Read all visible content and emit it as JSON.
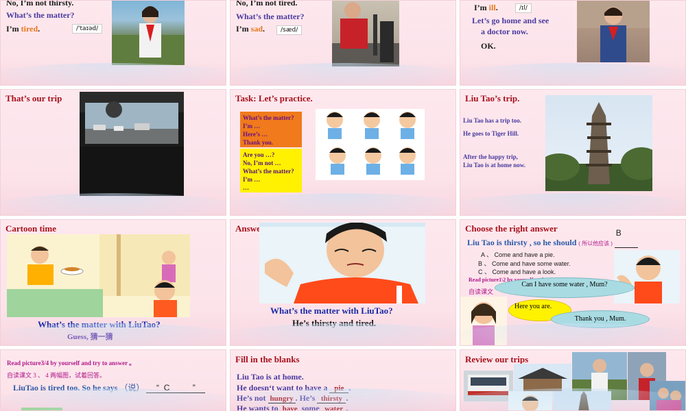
{
  "slide1": {
    "line1": "No, I’m not thirsty.",
    "line2": "What’s the matter?",
    "line3_prefix": "I’m ",
    "line3_word": "tired",
    "line3_suffix": ".",
    "phonetic": "/'taɪəd/"
  },
  "slide2": {
    "line1": "No, I’m not tired.",
    "line2": "What’s the matter?",
    "line3_prefix": "I’m ",
    "line3_word": "sad",
    "line3_suffix": ".",
    "phonetic": "/sæd/"
  },
  "slide3": {
    "line1_prefix": "I’m ",
    "line1_word": "ill",
    "line1_suffix": ".",
    "phonetic": "/ɪl/",
    "line2": "Let’s go home and see",
    "line3": "a doctor now.",
    "line4": "OK."
  },
  "slide4": {
    "title": "That’s our trip"
  },
  "slide5": {
    "title": "Task: Let’s practice.",
    "orange_box": [
      "What’s the matter?",
      "I’m …",
      "Here’s …",
      "Thank you."
    ],
    "yellow_box": [
      "Are you …?",
      "No, I’m not …",
      "What’s the matter?",
      "I’m …",
      "…"
    ]
  },
  "slide6": {
    "title": "Liu Tao’s trip.",
    "line1": "Liu Tao has a trip too.",
    "line2": "He goes to Tiger Hill.",
    "line3": "After the happy trip,",
    "line4": "Liu Tao is at home now."
  },
  "slide7": {
    "title": "Cartoon time",
    "question": "What’s the matter with LiuTao?",
    "hint": "Guess, 猜一猜"
  },
  "slide8": {
    "title": "Answer the question",
    "question": "What’s the matter with LiuTao?",
    "answer": "He’s thirsty and tired."
  },
  "slide9": {
    "title": "Choose the right answer",
    "sentence": "Liu Tao is thirsty , so he should",
    "note": "( 所以他应该 )",
    "answer": "B",
    "options": [
      "A 、 Come and have a pie.",
      "B 、 Come and have some water.",
      "C 、 Come and have a look."
    ],
    "instruction": "Read picture1\\2 by yourself and try to answer 。",
    "instruction_cn": "自读课文",
    "bubble1": "Can I have some water , Mum?",
    "bubble2": "Here you are.",
    "bubble3": "Thank you , Mum."
  },
  "slide10": {
    "instruction": "Read picture3/4  by yourself and try to answer 。",
    "instruction_cn": "自读课文 3 、 4 两幅图，试着回答。",
    "sentence": "LiuTao is tired too. So he says",
    "says_cn": "（说）",
    "answer": "C"
  },
  "slide11": {
    "title": "Fill in the blanks",
    "line1": "Liu Tao is at home.",
    "line2_prefix": "He doesn‘t want to have a",
    "blank1": "pie",
    "line3_prefix": "He’s not",
    "blank2": "hungry",
    "line3_mid": ". He’s",
    "blank3": "thirsty",
    "line4_prefix": "He wants to",
    "blank4": "have",
    "line4_mid": "some",
    "blank5": "water"
  },
  "slide12": {
    "title": "Review our trips"
  }
}
